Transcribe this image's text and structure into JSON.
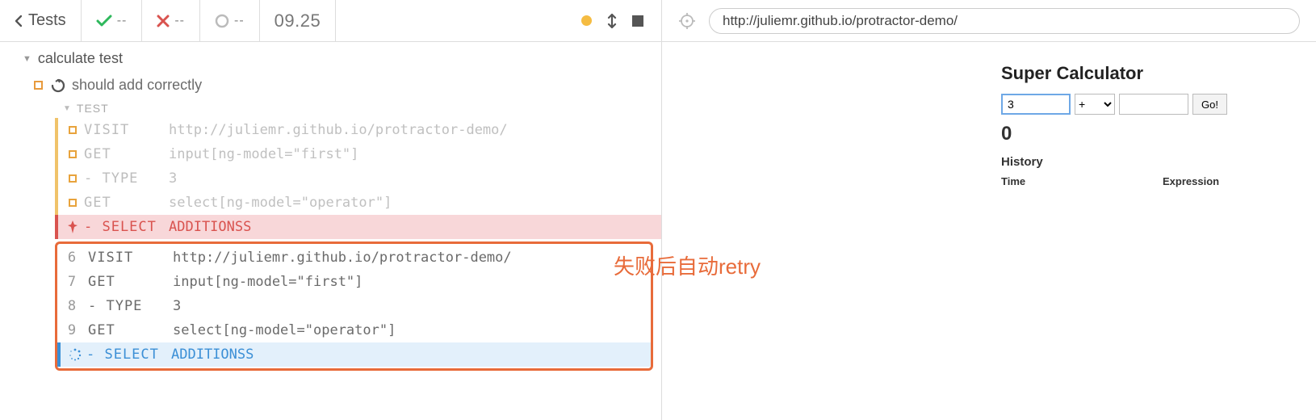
{
  "toolbar": {
    "back_label": "Tests",
    "pass_count": "--",
    "fail_count": "--",
    "pending_count": "--",
    "duration": "09.25"
  },
  "suite": {
    "title": "calculate test",
    "test_title": "should add correctly"
  },
  "log": {
    "section_label": "TEST",
    "first_pass": [
      {
        "name": "VISIT",
        "msg": "http://juliemr.github.io/protractor-demo/"
      },
      {
        "name": "GET",
        "msg": "input[ng-model=\"first\"]"
      },
      {
        "name": "- TYPE",
        "msg": "3"
      },
      {
        "name": "GET",
        "msg": "select[ng-model=\"operator\"]"
      }
    ],
    "error_row": {
      "name": "- SELECT",
      "msg": "ADDITIONSS"
    },
    "retry_rows": [
      {
        "num": "6",
        "name": "VISIT",
        "msg": "http://juliemr.github.io/protractor-demo/"
      },
      {
        "num": "7",
        "name": "GET",
        "msg": "input[ng-model=\"first\"]"
      },
      {
        "num": "8",
        "name": "- TYPE",
        "msg": "3"
      },
      {
        "num": "9",
        "name": "GET",
        "msg": "select[ng-model=\"operator\"]"
      }
    ],
    "retry_running": {
      "name": "- SELECT",
      "msg": "ADDITIONSS"
    }
  },
  "annotation": "失败后自动retry",
  "url": "http://juliemr.github.io/protractor-demo/",
  "calculator": {
    "title": "Super Calculator",
    "first_value": "3",
    "operator": "+",
    "second_value": "",
    "go_label": "Go!",
    "result": "0",
    "history_label": "History",
    "col_time": "Time",
    "col_expr": "Expression"
  }
}
